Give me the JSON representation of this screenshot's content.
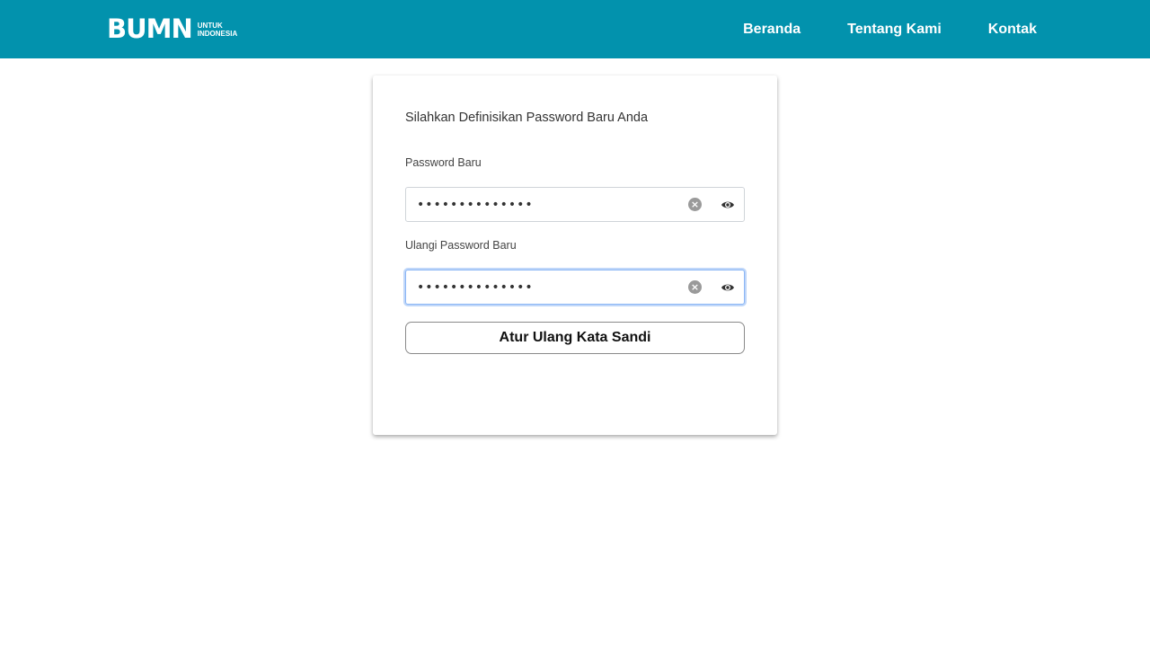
{
  "navbar": {
    "brand": {
      "mark": "BUMN",
      "tagline_line1": "UNTUK",
      "tagline_line2": "INDONESIA"
    },
    "links": [
      "Beranda",
      "Tentang Kami",
      "Kontak"
    ],
    "background_color": "#0292ad"
  },
  "form": {
    "title": "Silahkan Definisikan Password Baru Anda",
    "new_password": {
      "label": "Password Baru",
      "value": "••••••••••••••",
      "clear_icon": "clear-circle-icon",
      "toggle_icon": "eye-icon"
    },
    "confirm_password": {
      "label": "Ulangi Password Baru",
      "value": "••••••••••••••",
      "focused": true,
      "clear_icon": "clear-circle-icon",
      "toggle_icon": "eye-icon"
    },
    "submit_label": "Atur Ulang Kata Sandi"
  }
}
